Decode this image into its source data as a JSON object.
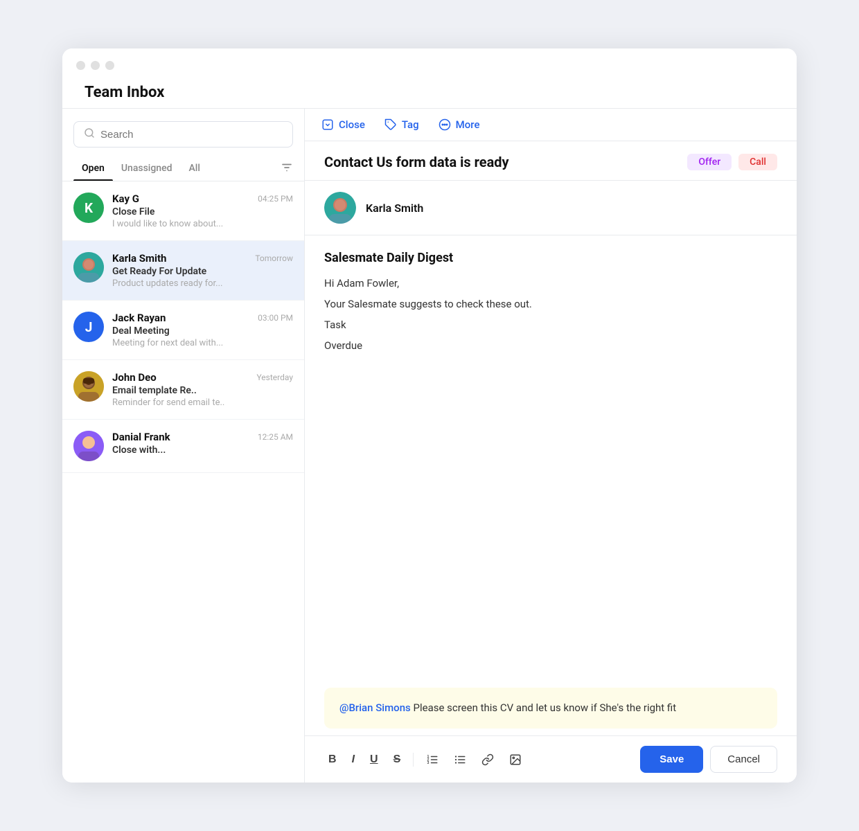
{
  "window": {
    "title": "Team Inbox"
  },
  "search": {
    "placeholder": "Search"
  },
  "tabs": [
    {
      "id": "open",
      "label": "Open",
      "active": true
    },
    {
      "id": "unassigned",
      "label": "Unassigned",
      "active": false
    },
    {
      "id": "all",
      "label": "All",
      "active": false
    }
  ],
  "conversations": [
    {
      "id": "conv1",
      "name": "Kay G",
      "time": "04:25 PM",
      "subject": "Close File",
      "preview": "I would like to know about...",
      "avatarType": "initials",
      "avatarInitial": "K",
      "avatarColor": "#22a85a",
      "selected": false
    },
    {
      "id": "conv2",
      "name": "Karla Smith",
      "time": "Tomorrow",
      "subject": "Get Ready For Update",
      "preview": "Product updates ready for...",
      "avatarType": "image",
      "avatarColor": "#2da89e",
      "selected": true
    },
    {
      "id": "conv3",
      "name": "Jack Rayan",
      "time": "03:00 PM",
      "subject": "Deal Meeting",
      "preview": "Meeting for next deal with...",
      "avatarType": "initials",
      "avatarInitial": "J",
      "avatarColor": "#2563eb",
      "selected": false
    },
    {
      "id": "conv4",
      "name": "John Deo",
      "time": "Yesterday",
      "subject": "Email template Re..",
      "preview": "Reminder for send email te..",
      "avatarType": "image",
      "avatarColor": "#c9a227",
      "selected": false
    },
    {
      "id": "conv5",
      "name": "Danial Frank",
      "time": "12:25 AM",
      "subject": "Close with...",
      "preview": "",
      "avatarType": "image",
      "avatarColor": "#8b5cf6",
      "selected": false
    }
  ],
  "toolbar": {
    "close_label": "Close",
    "tag_label": "Tag",
    "more_label": "More"
  },
  "email": {
    "subject": "Contact Us form data is ready",
    "badge_offer": "Offer",
    "badge_call": "Call",
    "sender_name": "Karla Smith",
    "email_subject": "Salesmate Daily Digest",
    "greeting": "Hi Adam Fowler,",
    "line1": "Your Salesmate suggests to check these out.",
    "line2": "Task",
    "line3": "Overdue"
  },
  "note": {
    "mention": "@Brian Simons",
    "text": " Please screen this CV and let us know if She's the right fit"
  },
  "editor": {
    "bold": "B",
    "italic": "I",
    "underline": "U",
    "strikethrough": "S",
    "save_label": "Save",
    "cancel_label": "Cancel"
  }
}
